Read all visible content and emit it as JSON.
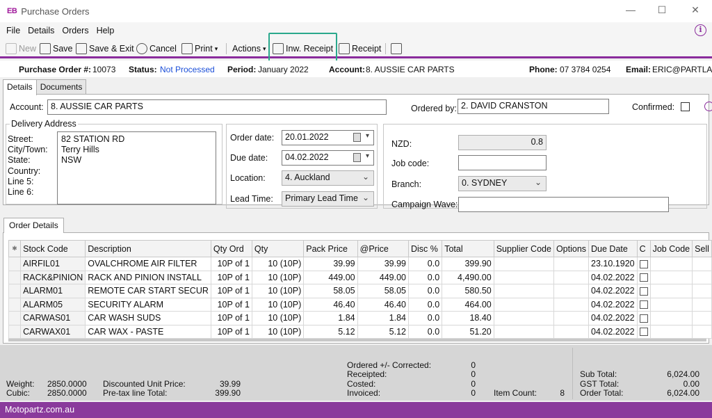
{
  "window": {
    "logo": "EB",
    "title": "Purchase Orders",
    "minimize": "—",
    "maximize": "☐",
    "close": "✕"
  },
  "menu": [
    "File",
    "Details",
    "Orders",
    "Help"
  ],
  "toolbar": {
    "new": "New",
    "save": "Save",
    "save_exit": "Save & Exit",
    "cancel": "Cancel",
    "print": "Print",
    "print_arrow": "▾",
    "actions": "Actions",
    "actions_arrow": "▾",
    "inw_receipt": "Inw. Receipt",
    "receipt": "Receipt"
  },
  "header": {
    "po_label": "Purchase Order #:",
    "po_value": "10073",
    "status_label": "Status:",
    "status_value": "Not Processed",
    "period_label": "Period:",
    "period_value": "January 2022",
    "account_label": "Account:",
    "account_value": "8. AUSSIE CAR PARTS",
    "phone_label": "Phone:",
    "phone_value": "07 3784 0254",
    "email_label": "Email:",
    "email_value": "ERIC@PARTLAN"
  },
  "tabs": [
    "Details",
    "Documents"
  ],
  "details": {
    "account_label": "Account:",
    "account_value": "8. AUSSIE CAR PARTS",
    "ordered_by_label": "Ordered by:",
    "ordered_by_value": "2. DAVID CRANSTON",
    "confirmed_label": "Confirmed:",
    "delivery_title": "Delivery Address",
    "street_label": "Street:",
    "city_label": "City/Town:",
    "state_label": "State:",
    "country_label": "Country:",
    "line5_label": "Line 5:",
    "line6_label": "Line 6:",
    "street_value": "82 STATION RD",
    "city_value": "Terry Hills",
    "state_value": "NSW",
    "order_date_label": "Order date:",
    "order_date_value": "20.01.2022",
    "due_date_label": "Due date:",
    "due_date_value": "04.02.2022",
    "location_label": "Location:",
    "location_value": "4. Auckland",
    "lead_time_label": "Lead Time:",
    "lead_time_value": "Primary Lead Time",
    "nzd_label": "NZD:",
    "nzd_value": "0.8",
    "job_code_label": "Job code:",
    "branch_label": "Branch:",
    "branch_value": "0. SYDNEY",
    "campaign_label": "Campaign Wave:"
  },
  "order_details_tab": "Order Details",
  "grid": {
    "marker": "✱",
    "columns": [
      "Stock Code",
      "Description",
      "Qty Ord",
      "Qty",
      "Pack Price",
      "@Price",
      "Disc %",
      "Total",
      "Supplier Code",
      "Options",
      "Due Date",
      "C",
      "Job Code",
      "Sell"
    ],
    "rows": [
      {
        "stock": "AIRFIL01",
        "desc": "OVALCHROME AIR FILTER",
        "qty_ord": "10P of 1",
        "qty": "10 (10P)",
        "pack": "39.99",
        "price": "39.99",
        "disc": "0.0",
        "total": "399.90",
        "due": "23.10.1920"
      },
      {
        "stock": "RACK&PINION",
        "desc": "RACK AND PINION INSTALL",
        "qty_ord": "10P of 1",
        "qty": "10 (10P)",
        "pack": "449.00",
        "price": "449.00",
        "disc": "0.0",
        "total": "4,490.00",
        "due": "04.02.2022"
      },
      {
        "stock": "ALARM01",
        "desc": "REMOTE CAR START SECUR",
        "qty_ord": "10P of 1",
        "qty": "10 (10P)",
        "pack": "58.05",
        "price": "58.05",
        "disc": "0.0",
        "total": "580.50",
        "due": "04.02.2022"
      },
      {
        "stock": "ALARM05",
        "desc": "SECURITY ALARM",
        "qty_ord": "10P of 1",
        "qty": "10 (10P)",
        "pack": "46.40",
        "price": "46.40",
        "disc": "0.0",
        "total": "464.00",
        "due": "04.02.2022"
      },
      {
        "stock": "CARWAS01",
        "desc": "CAR WASH SUDS",
        "qty_ord": "10P of 1",
        "qty": "10 (10P)",
        "pack": "1.84",
        "price": "1.84",
        "disc": "0.0",
        "total": "18.40",
        "due": "04.02.2022"
      },
      {
        "stock": "CARWAX01",
        "desc": "CAR WAX - PASTE",
        "qty_ord": "10P of 1",
        "qty": "10 (10P)",
        "pack": "5.12",
        "price": "5.12",
        "disc": "0.0",
        "total": "51.20",
        "due": "04.02.2022"
      }
    ]
  },
  "footer": {
    "weight_label": "Weight:",
    "weight_value": "2850.0000",
    "cubic_label": "Cubic:",
    "cubic_value": "2850.0000",
    "disc_unit_label": "Discounted Unit Price:",
    "disc_unit_value": "39.99",
    "pretax_label": "Pre-tax line Total:",
    "pretax_value": "399.90",
    "ordered_label": "Ordered +/- Corrected:",
    "ordered_value": "0",
    "receipted_label": "Receipted:",
    "receipted_value": "0",
    "costed_label": "Costed:",
    "costed_value": "0",
    "invoiced_label": "Invoiced:",
    "invoiced_value": "0",
    "item_count_label": "Item Count:",
    "item_count_value": "8",
    "subtotal_label": "Sub Total:",
    "subtotal_value": "6,024.00",
    "gst_label": "GST Total:",
    "gst_value": "0.00",
    "order_total_label": "Order Total:",
    "order_total_value": "6,024.00"
  },
  "statusbar": "Motopartz.com.au",
  "colors": {
    "accent": "#8a3a9c",
    "highlight": "#2aa88c",
    "status": "#1a4ed8"
  }
}
